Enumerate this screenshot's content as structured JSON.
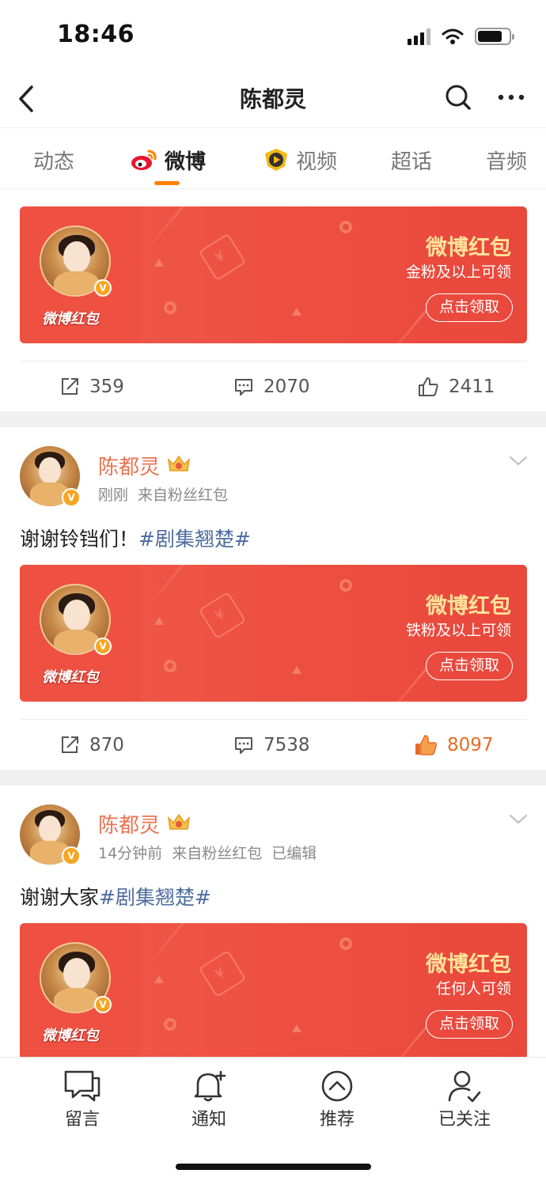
{
  "status_bar": {
    "time": "18:46"
  },
  "nav": {
    "title": "陈都灵"
  },
  "tabs": [
    {
      "label": "动态"
    },
    {
      "label": "微博"
    },
    {
      "label": "视频"
    },
    {
      "label": "超话"
    },
    {
      "label": "音频"
    }
  ],
  "packet_common": {
    "title": "微博红包",
    "button": "点击领取",
    "tile_label": "微博红包"
  },
  "post0": {
    "packet_subtitle": "金粉及以上可领",
    "reposts": "359",
    "comments": "2070",
    "likes": "2411"
  },
  "post1": {
    "author": "陈都灵",
    "time": "刚刚",
    "source": "来自粉丝红包",
    "text": "谢谢铃铛们！",
    "hashtag": "#剧集翘楚#",
    "packet_subtitle": "铁粉及以上可领",
    "reposts": "870",
    "comments": "7538",
    "likes": "8097",
    "liked": true
  },
  "post2": {
    "author": "陈都灵",
    "time": "14分钟前",
    "source": "来自粉丝红包",
    "edited": "已编辑",
    "text": "谢谢大家",
    "hashtag": "#剧集翘楚#",
    "packet_subtitle": "任何人可领"
  },
  "bottom_bar": [
    {
      "label": "留言",
      "icon": "comment-icon"
    },
    {
      "label": "通知",
      "icon": "bell-icon"
    },
    {
      "label": "推荐",
      "icon": "recommend-icon"
    },
    {
      "label": "已关注",
      "icon": "followed-icon"
    }
  ],
  "colors": {
    "accent": "#ff8200",
    "name": "#eb7350",
    "hashtag": "#4d6ca0",
    "packet": "#ec4e40",
    "liked": "#e86b24"
  }
}
